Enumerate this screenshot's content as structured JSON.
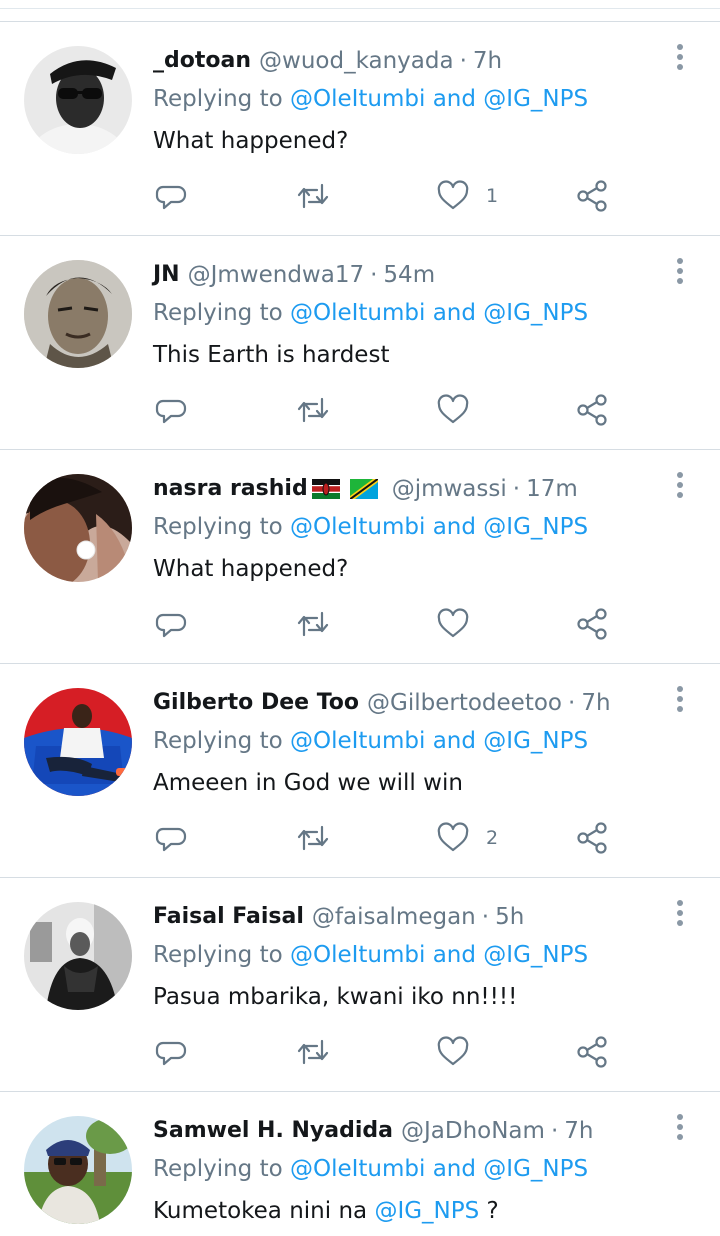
{
  "feed": {
    "replies": [
      {
        "name": "_dotoan",
        "handle": "@wuod_kanyada",
        "dot": "·",
        "age": "7h",
        "reply_prefix": "Replying to",
        "reply_mentions": "@OleItumbi and @IG_NPS",
        "text": "What happened?",
        "like_count": "1",
        "avatar": "avatar-dotoan"
      },
      {
        "name": "JN",
        "handle": "@Jmwendwa17",
        "dot": "·",
        "age": "54m",
        "reply_prefix": "Replying to",
        "reply_mentions": "@OleItumbi and @IG_NPS",
        "text": "This Earth is hardest",
        "like_count": "",
        "avatar": "avatar-jn"
      },
      {
        "name": "nasra rashid",
        "handle": "@jmwassi",
        "dot": "·",
        "age": "17m",
        "reply_prefix": "Replying to",
        "reply_mentions": "@OleItumbi and @IG_NPS",
        "text": "What happened?",
        "like_count": "",
        "avatar": "avatar-nasra",
        "flags": [
          "kenya-flag-icon",
          "tanzania-flag-icon"
        ]
      },
      {
        "name": "Gilberto Dee Too",
        "handle": "@Gilbertodeetoo",
        "dot": "·",
        "age": "7h",
        "reply_prefix": "Replying to",
        "reply_mentions": "@OleItumbi and @IG_NPS",
        "text": "Ameeen in God we will win",
        "like_count": "2",
        "avatar": "avatar-gilberto"
      },
      {
        "name": "Faisal Faisal",
        "handle": "@faisalmegan",
        "dot": "·",
        "age": "5h",
        "reply_prefix": "Replying to",
        "reply_mentions": "@OleItumbi and @IG_NPS",
        "text": "Pasua mbarika, kwani iko nn!!!!",
        "like_count": "",
        "avatar": "avatar-faisal"
      },
      {
        "name": "Samwel H. Nyadida",
        "handle": "@JaDhoNam",
        "dot": "·",
        "age": "7h",
        "reply_prefix": "Replying to",
        "reply_mentions": "@OleItumbi and @IG_NPS",
        "text": "Kumetokea nini na",
        "text_mention": "@IG_NPS",
        "text_suffix": "?",
        "avatar": "avatar-samwel"
      }
    ]
  },
  "icons": {
    "reply": "reply-icon",
    "retweet": "retweet-icon",
    "like": "heart-icon",
    "share": "share-icon",
    "more": "more-vertical-icon"
  },
  "colors": {
    "link": "#1d9bf0",
    "secondary_text": "#657786",
    "primary_text": "#14171a",
    "divider": "#d6dde3"
  }
}
